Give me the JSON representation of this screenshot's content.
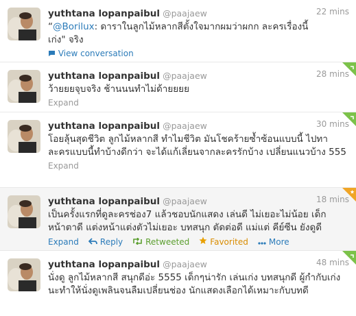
{
  "tweets": [
    {
      "name": "yuthtana lopanpaibul",
      "handle": "@paajaew",
      "time": "22 mins",
      "mention": "@Borilux",
      "text_after_mention": ": ดาราในลูกไม้หลากสีตั้งใจมากผมว่าผกก ละครเรื่องนี้เก่ง\" จริง",
      "link": "View conversation"
    },
    {
      "name": "yuthtana lopanpaibul",
      "handle": "@paajaew",
      "time": "28 mins",
      "text": "ว้ายยยจุบจริง ช้านนนทำไม่ด้ายยยย",
      "link": "Expand"
    },
    {
      "name": "yuthtana lopanpaibul",
      "handle": "@paajaew",
      "time": "30 mins",
      "text": "โอยลุ้นสุดชีวิต ลูกไม้หลากสี ทำไมชีวิต มันโชคร้ายซ้ำซ้อนแบบนี้ ไปทาละครแบบนี้ทำบ้างดีกว่า จะได้แก้เลี่ยนจากละครรักบ้าง เปลี่ยนแนวบ้าง 555",
      "link": "Expand"
    },
    {
      "name": "yuthtana lopanpaibul",
      "handle": "@paajaew",
      "time": "18 mins",
      "text": "เป็นครั้งแรกที่ดูละครช่อง7 แล้วชอบนักแสดง เล่นดี ไม่เยอะไม่น้อย เด็กหน้าตาดี แต่งหน้าแต่งตัวไม่เยอะ บทสนุก ตัดต่อดี แม่แต่ คีย์ซีน ยังดูดี",
      "actions": {
        "expand": "Expand",
        "reply": "Reply",
        "retweeted": "Retweeted",
        "favorited": "Favorited",
        "more": "More"
      }
    },
    {
      "name": "yuthtana lopanpaibul",
      "handle": "@paajaew",
      "time": "48 mins",
      "text": "นั่งดู ลูกไม้หลากสี สนุกดีอ่ะ 5555 เด็กๆน่ารัก เล่นเก่ง บทสนุกดี ผู้กำกับเก่งนะทำให้นั่งดูเพลินจนลืมเปลี่ยนช่อง นักแสดงเลือกได้เหมาะกับบทดี"
    }
  ],
  "icons": {
    "conversation": "speech-bubble-icon",
    "reply": "reply-arrow-icon",
    "retweet": "retweet-icon",
    "favorite": "star-icon",
    "more": "ellipsis-icon",
    "retweet_corner": "green-corner-badge",
    "favorite_corner": "orange-corner-badge"
  },
  "colors": {
    "link": "#2b7bb9",
    "retweeted": "#5b9e2e",
    "favorited": "#d98c00",
    "meta": "#999999"
  }
}
